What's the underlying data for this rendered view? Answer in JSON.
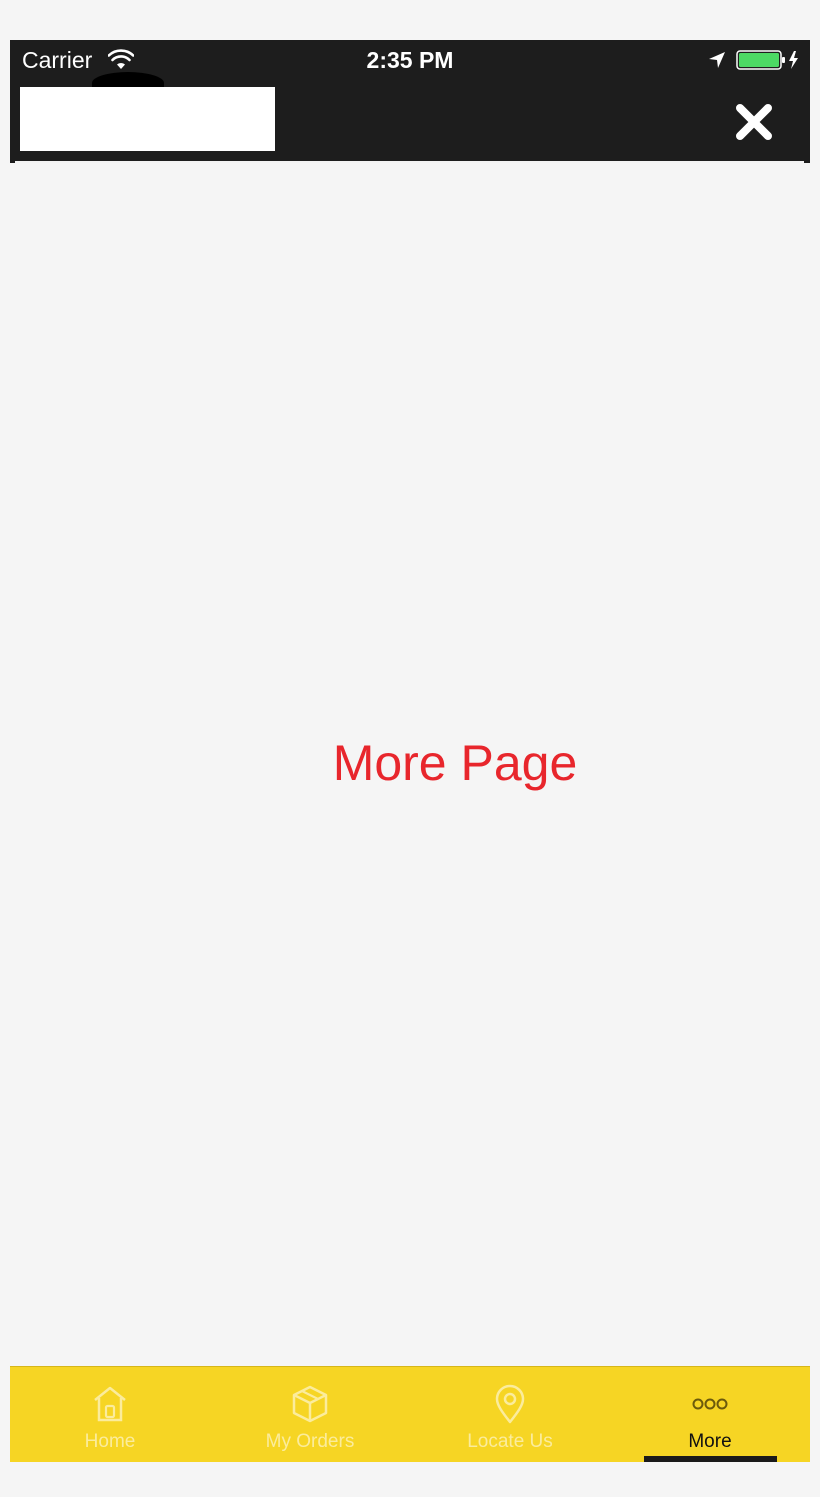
{
  "status_bar": {
    "carrier": "Carrier",
    "time": "2:35 PM",
    "wifi_icon": "wifi-icon",
    "location_icon": "location-arrow-icon",
    "battery_icon": "battery-charging-icon"
  },
  "header": {
    "close_icon": "close-icon"
  },
  "main": {
    "title": "More Page",
    "title_color": "#e8262c"
  },
  "tab_bar": {
    "background": "#f6d524",
    "tabs": [
      {
        "label": "Home",
        "icon": "home-icon",
        "active": false
      },
      {
        "label": "My Orders",
        "icon": "package-icon",
        "active": false
      },
      {
        "label": "Locate Us",
        "icon": "map-pin-icon",
        "active": false
      },
      {
        "label": "More",
        "icon": "more-dots-icon",
        "active": true
      }
    ]
  },
  "colors": {
    "header_bg": "#1d1d1d",
    "page_bg": "#f5f5f5",
    "active_tab_indicator": "#1a1a1a"
  }
}
